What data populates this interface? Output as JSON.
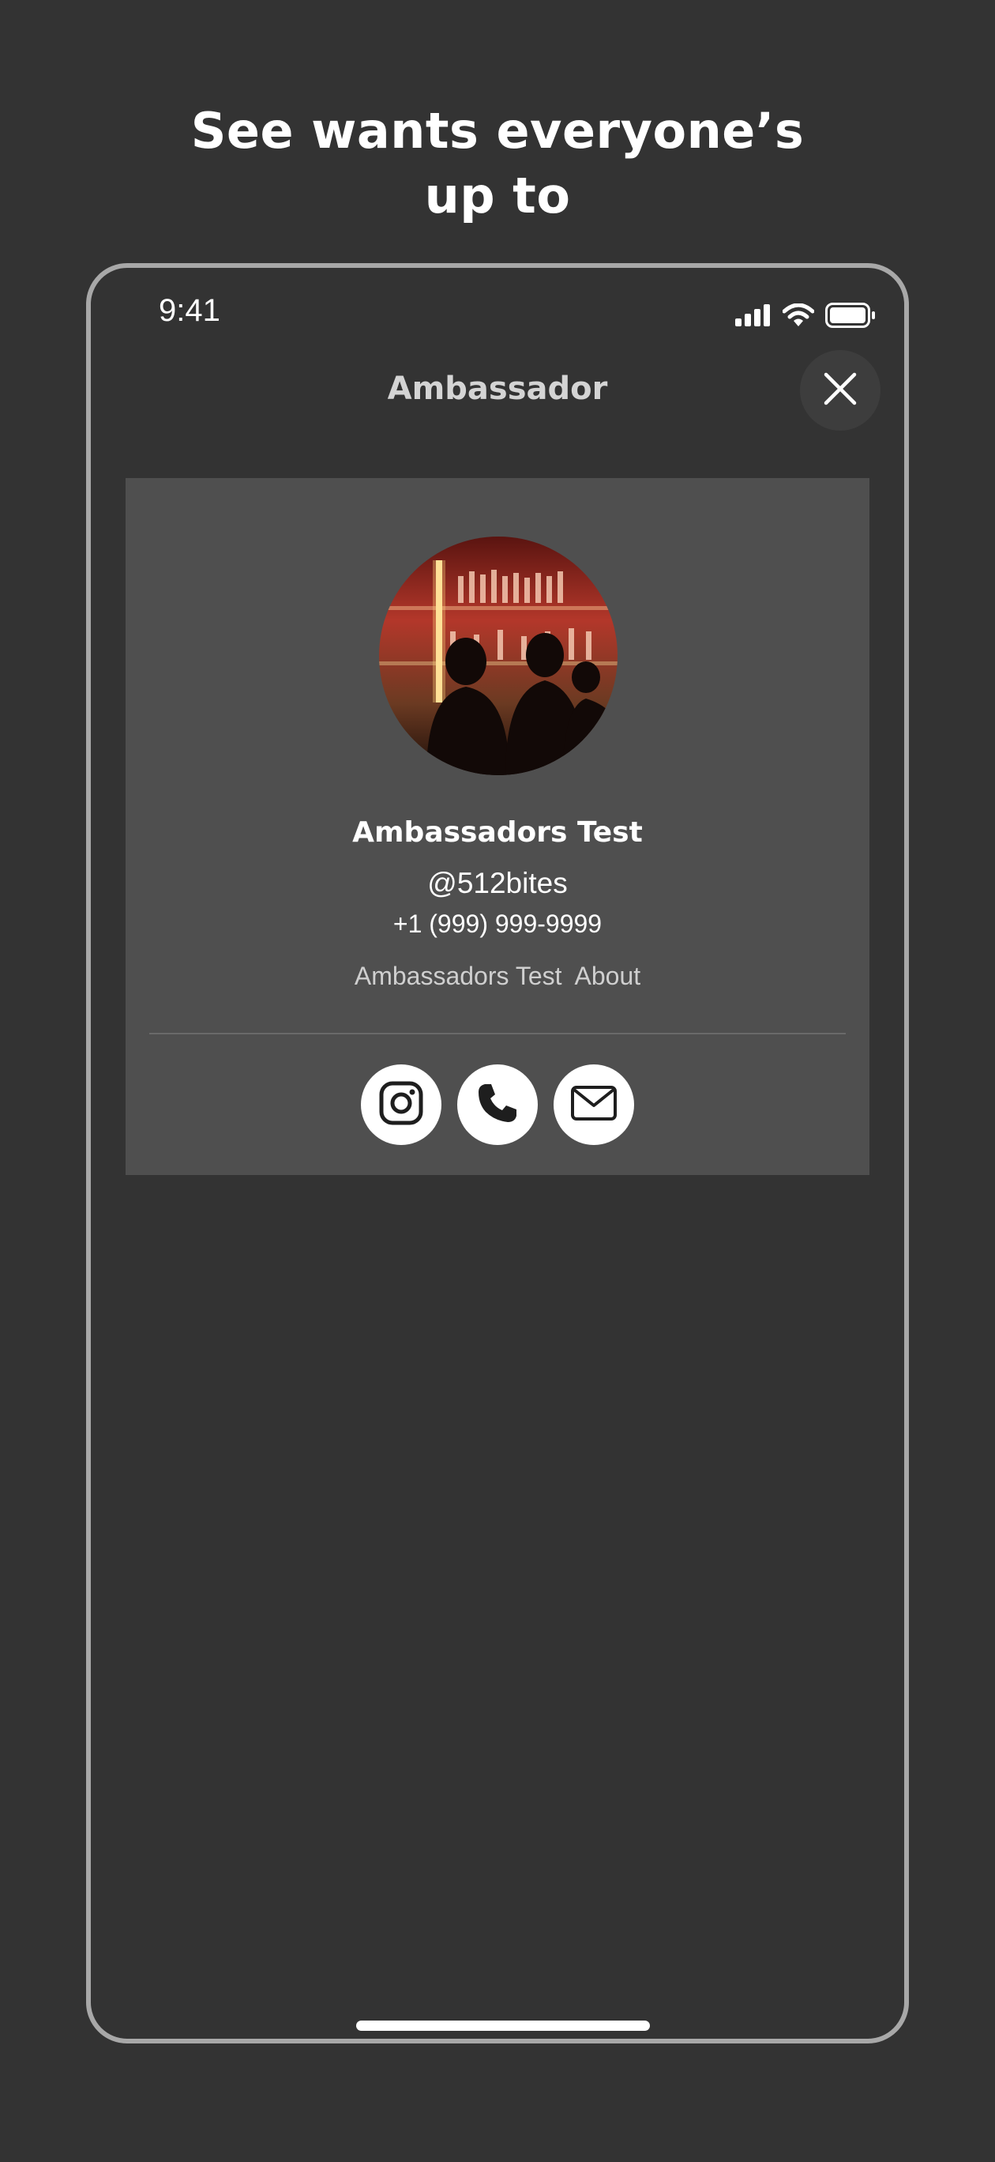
{
  "headline": {
    "line1": "See wants everyone’s",
    "line2": "up to"
  },
  "status_bar": {
    "time": "9:41"
  },
  "nav": {
    "title": "Ambassador",
    "close_icon": "close-icon"
  },
  "profile": {
    "name": "Ambassadors Test",
    "handle": "@512bites",
    "phone": "+1 (999) 999-9999",
    "meta_name": "Ambassadors Test",
    "meta_link": "About",
    "avatar_description": "bar-photo"
  },
  "actions": [
    {
      "icon": "instagram-icon"
    },
    {
      "icon": "phone-icon"
    },
    {
      "icon": "mail-icon"
    }
  ],
  "colors": {
    "background": "#333333",
    "card": "#4f4f4f",
    "frame": "#a8a8a8",
    "accent_red": "#c0362c"
  }
}
